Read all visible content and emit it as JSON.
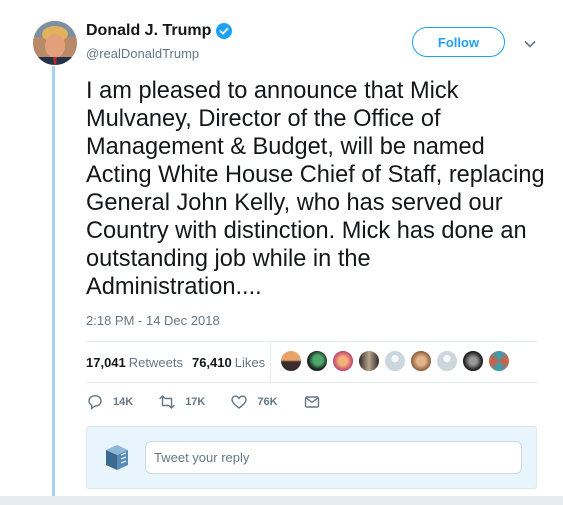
{
  "author": {
    "name": "Donald J. Trump",
    "handle": "@realDonaldTrump",
    "verified": true,
    "follow_label": "Follow"
  },
  "tweet": {
    "text": "I am pleased to announce that Mick Mulvaney, Director of the Office of Management & Budget, will be named Acting White House Chief of Staff, replacing General John Kelly, who has served our Country with distinction. Mick has done an outstanding job while in the Administration....",
    "timestamp": "2:18 PM - 14 Dec 2018"
  },
  "stats": {
    "retweets_count": "17,041",
    "retweets_label": "Retweets",
    "likes_count": "76,410",
    "likes_label": "Likes"
  },
  "actions": {
    "reply_count": "14K",
    "retweet_count": "17K",
    "like_count": "76K"
  },
  "reply": {
    "placeholder": "Tweet your reply"
  },
  "colors": {
    "accent": "#1da1f2",
    "thread_line": "#a6d4f2",
    "muted_text": "#657786"
  }
}
